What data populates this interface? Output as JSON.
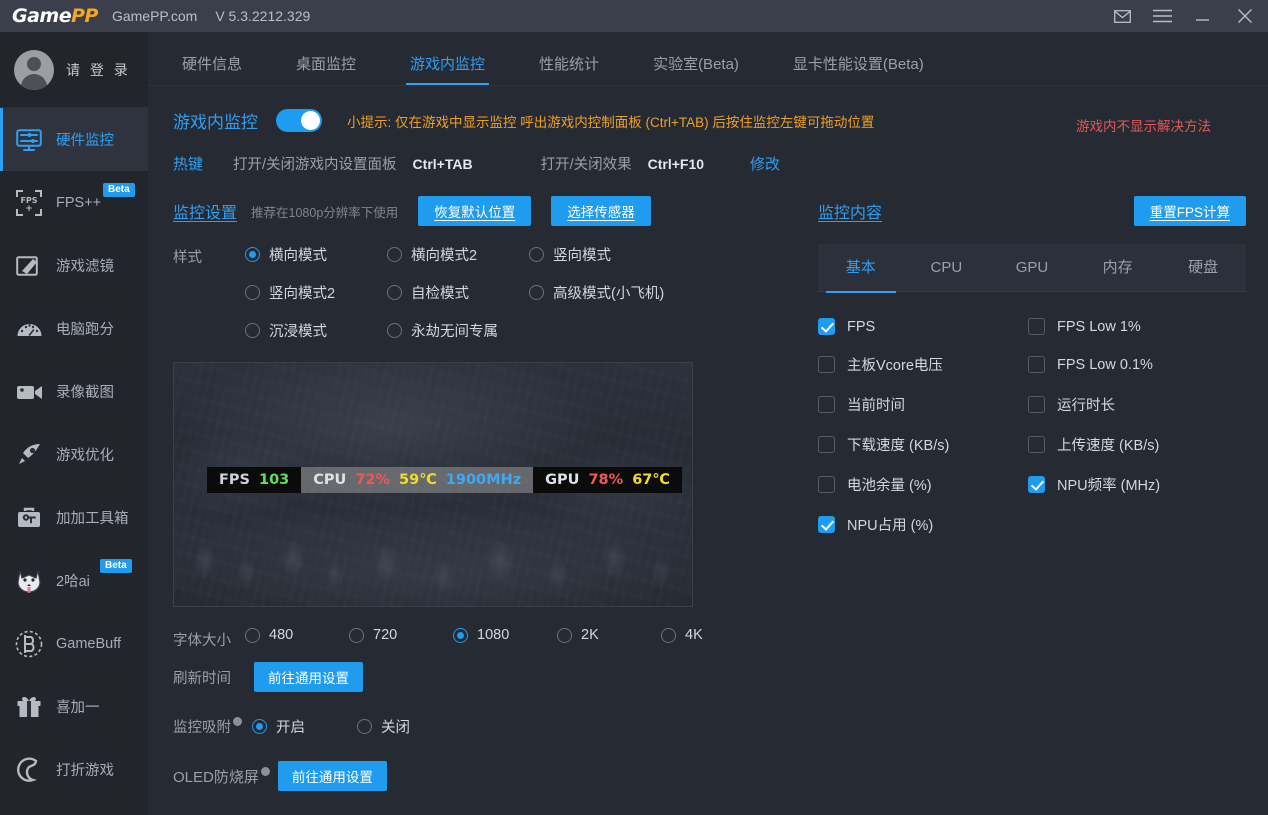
{
  "titlebar": {
    "logo_main": "Game",
    "logo_accent": "PP",
    "site": "GamePP.com",
    "version": "V 5.3.2212.329",
    "buttons": [
      {
        "name": "mail-icon",
        "label": "✉"
      },
      {
        "name": "menu-icon",
        "label": "≡"
      },
      {
        "name": "minimize-icon",
        "label": "—"
      },
      {
        "name": "close-icon",
        "label": "✕"
      }
    ]
  },
  "sidebar": {
    "account_label": "请 登 录",
    "items": [
      {
        "label": "硬件监控",
        "icon": "monitor-icon",
        "active": true,
        "badge": ""
      },
      {
        "label": "FPS++",
        "icon": "fps-icon",
        "active": false,
        "badge": "Beta"
      },
      {
        "label": "游戏滤镜",
        "icon": "filter-icon",
        "active": false,
        "badge": ""
      },
      {
        "label": "电脑跑分",
        "icon": "gauge-icon",
        "active": false,
        "badge": ""
      },
      {
        "label": "录像截图",
        "icon": "camera-icon",
        "active": false,
        "badge": ""
      },
      {
        "label": "游戏优化",
        "icon": "rocket-icon",
        "active": false,
        "badge": ""
      },
      {
        "label": "加加工具箱",
        "icon": "toolbox-icon",
        "active": false,
        "badge": ""
      },
      {
        "label": "2哈ai",
        "icon": "husky-icon",
        "active": false,
        "badge": "Beta"
      },
      {
        "label": "GameBuff",
        "icon": "gamebuff-icon",
        "active": false,
        "badge": ""
      },
      {
        "label": "喜加一",
        "icon": "gift-icon",
        "active": false,
        "badge": ""
      },
      {
        "label": "打折游戏",
        "icon": "discount-icon",
        "active": false,
        "badge": ""
      }
    ]
  },
  "tabs": [
    {
      "label": "硬件信息",
      "active": false
    },
    {
      "label": "桌面监控",
      "active": false
    },
    {
      "label": "游戏内监控",
      "active": true
    },
    {
      "label": "性能统计",
      "active": false
    },
    {
      "label": "实验室(Beta)",
      "active": false
    },
    {
      "label": "显卡性能设置(Beta)",
      "active": false
    }
  ],
  "ingame": {
    "title": "游戏内监控",
    "toggle_on": true,
    "tip": "小提示: 仅在游戏中显示监控 呼出游戏内控制面板 (Ctrl+TAB) 后按住监控左键可拖动位置"
  },
  "hotkey": {
    "label": "热键",
    "item1_label": "打开/关闭游戏内设置面板",
    "item1_key": "Ctrl+TAB",
    "item2_label": "打开/关闭效果",
    "item2_key": "Ctrl+F10",
    "modify": "修改",
    "warning": "游戏内不显示解决方法"
  },
  "monitor_settings": {
    "title": "监控设置",
    "hint": "推荐在1080p分辨率下使用",
    "btn_reset_pos": "恢复默认位置",
    "btn_select_sensor": "选择传感器",
    "style_label": "样式",
    "styles": [
      {
        "label": "横向模式",
        "selected": true
      },
      {
        "label": "横向模式2",
        "selected": false
      },
      {
        "label": "竖向模式",
        "selected": false
      },
      {
        "label": "竖向模式2",
        "selected": false
      },
      {
        "label": "自检模式",
        "selected": false
      },
      {
        "label": "高级模式(小飞机)",
        "selected": false
      },
      {
        "label": "沉浸模式",
        "selected": false
      },
      {
        "label": "永劫无间专属",
        "selected": false
      }
    ],
    "font_size_label": "字体大小",
    "font_sizes": [
      {
        "label": "480",
        "selected": false
      },
      {
        "label": "720",
        "selected": false
      },
      {
        "label": "1080",
        "selected": true
      },
      {
        "label": "2K",
        "selected": false
      },
      {
        "label": "4K",
        "selected": false
      }
    ],
    "refresh_label": "刷新时间",
    "refresh_btn": "前往通用设置",
    "snap_label": "监控吸附",
    "snap_options": [
      {
        "label": "开启",
        "selected": true
      },
      {
        "label": "关闭",
        "selected": false
      }
    ],
    "oled_label": "OLED防烧屏",
    "oled_btn": "前往通用设置"
  },
  "osd_preview": {
    "fps_key": "FPS",
    "fps_value": "103",
    "cpu_key": "CPU",
    "cpu_load": "72%",
    "cpu_temp": "59℃",
    "cpu_clock": "1900MHz",
    "gpu_key": "GPU",
    "gpu_load": "78%",
    "gpu_temp": "67℃"
  },
  "monitor_content": {
    "title": "监控内容",
    "reset_btn": "重置FPS计算",
    "tabs": [
      {
        "label": "基本",
        "active": true
      },
      {
        "label": "CPU",
        "active": false
      },
      {
        "label": "GPU",
        "active": false
      },
      {
        "label": "内存",
        "active": false
      },
      {
        "label": "硬盘",
        "active": false
      }
    ],
    "checkboxes": [
      {
        "label": "FPS",
        "checked": true
      },
      {
        "label": "FPS Low 1%",
        "checked": false
      },
      {
        "label": "主板Vcore电压",
        "checked": false
      },
      {
        "label": "FPS Low 0.1%",
        "checked": false
      },
      {
        "label": "当前时间",
        "checked": false
      },
      {
        "label": "运行时长",
        "checked": false
      },
      {
        "label": "下载速度 (KB/s)",
        "checked": false
      },
      {
        "label": "上传速度 (KB/s)",
        "checked": false
      },
      {
        "label": "电池余量 (%)",
        "checked": false
      },
      {
        "label": "NPU频率 (MHz)",
        "checked": true
      },
      {
        "label": "NPU占用 (%)",
        "checked": true
      }
    ]
  },
  "colors": {
    "accent": "#2f9ff2",
    "button": "#1f9cf0",
    "warning": "#e05a5a",
    "tip": "#f0a020",
    "logo_accent": "#f5a623"
  }
}
